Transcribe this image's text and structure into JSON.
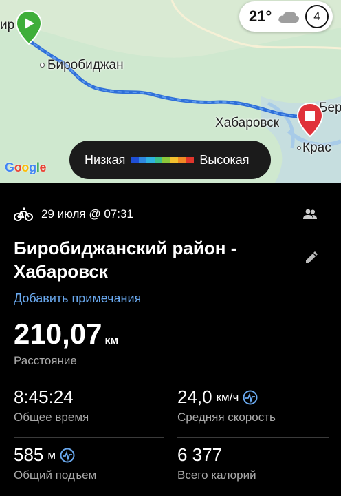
{
  "map": {
    "cities": {
      "birobidzhan": "Биробиджан",
      "khabarovsk": "Хабаровск",
      "bir_partial": "ир",
      "ber_partial": "Бер",
      "kras_partial": "Крас"
    },
    "weather": {
      "temperature": "21°",
      "icon": "cloud-icon",
      "compass_value": "4"
    },
    "google_logo": "Google",
    "legend": {
      "low_label": "Низкая",
      "high_label": "Высокая",
      "colors": [
        "#1f4fd6",
        "#2f88e0",
        "#2fb3e0",
        "#3cc18a",
        "#8cc83a",
        "#f2c12e",
        "#f08a24",
        "#e0362c"
      ]
    },
    "route_color": "#2f6fd8",
    "start_marker_color": "#3fae3a",
    "end_marker_color": "#e0323a"
  },
  "activity": {
    "type_icon": "bicycle-icon",
    "date": "29 июля @ 07:31",
    "title": "Биробиджанский район - Хабаровск",
    "add_note": "Добавить примечания",
    "distance": {
      "value": "210,07",
      "unit": "км",
      "label": "Расстояние"
    },
    "stats": [
      {
        "value": "8:45:24",
        "unit": "",
        "label": "Общее время",
        "pulse": false
      },
      {
        "value": "24,0",
        "unit": "км/ч",
        "label": "Средняя скорость",
        "pulse": true
      },
      {
        "value": "585",
        "unit": "м",
        "label": "Общий подъем",
        "pulse": true
      },
      {
        "value": "6 377",
        "unit": "",
        "label": "Всего калорий",
        "pulse": false
      }
    ],
    "accent_color": "#6aa9ef"
  }
}
